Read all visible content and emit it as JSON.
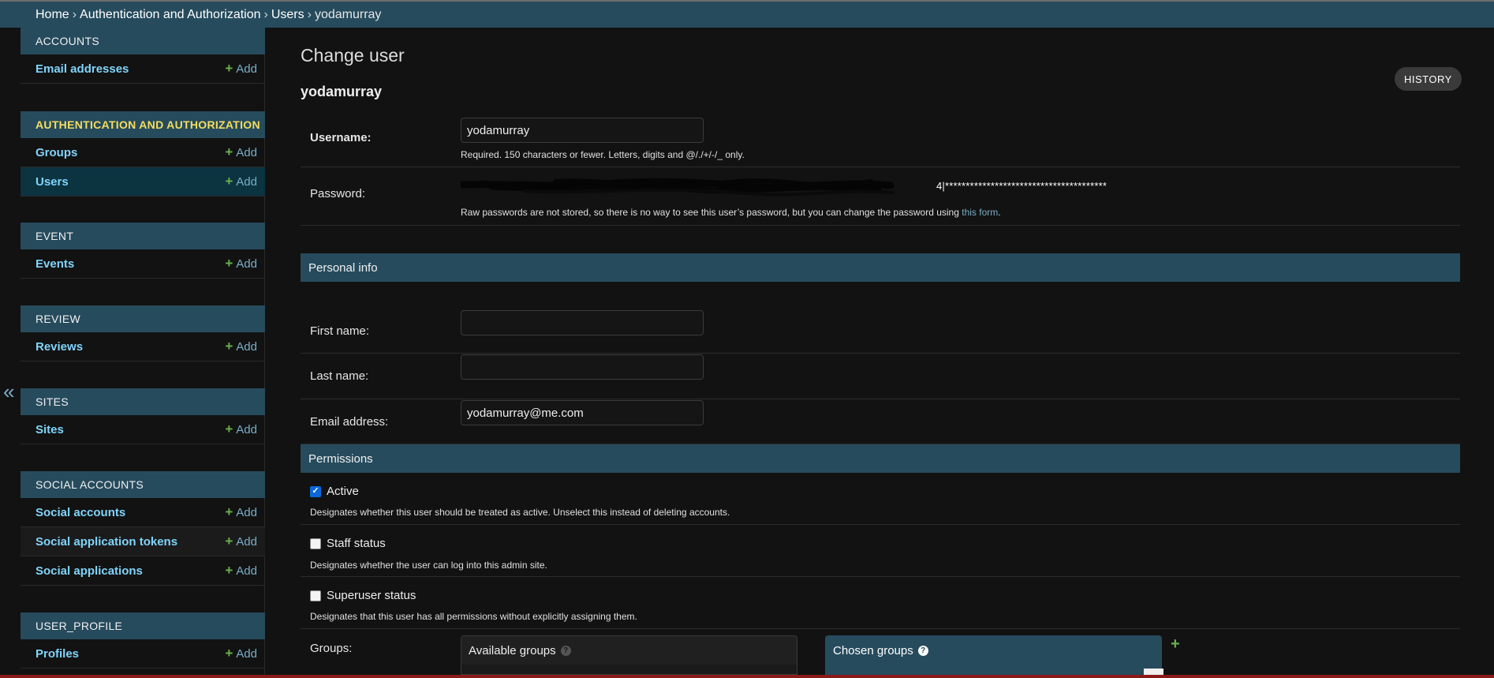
{
  "breadcrumbs": {
    "home": "Home",
    "app": "Authentication and Authorization",
    "model": "Users",
    "object": "yodamurray",
    "separator": "›"
  },
  "sidebar": {
    "collapse_symbol": "«",
    "add_label": "Add",
    "add_symbol": "+",
    "modules": [
      {
        "title": "ACCOUNTS",
        "items": [
          {
            "label": "Email addresses"
          }
        ]
      },
      {
        "title": "AUTHENTICATION AND AUTHORIZATION",
        "items": [
          {
            "label": "Groups"
          },
          {
            "label": "Users"
          }
        ]
      },
      {
        "title": "EVENT",
        "items": [
          {
            "label": "Events"
          }
        ]
      },
      {
        "title": "REVIEW",
        "items": [
          {
            "label": "Reviews"
          }
        ]
      },
      {
        "title": "SITES",
        "items": [
          {
            "label": "Sites"
          }
        ]
      },
      {
        "title": "SOCIAL ACCOUNTS",
        "items": [
          {
            "label": "Social accounts"
          },
          {
            "label": "Social application tokens"
          },
          {
            "label": "Social applications"
          }
        ]
      },
      {
        "title": "USER_PROFILE",
        "items": [
          {
            "label": "Profiles"
          }
        ]
      }
    ]
  },
  "main": {
    "title": "Change user",
    "object_name": "yodamurray",
    "history_label": "HISTORY",
    "username": {
      "label": "Username:",
      "value": "yodamurray",
      "help": "Required. 150 characters or fewer. Letters, digits and @/./+/-/_ only."
    },
    "password": {
      "label": "Password:",
      "masked": "4|***************************************",
      "help_prefix": "Raw passwords are not stored, so there is no way to see this user’s password, but you can change the password using ",
      "help_link": "this form",
      "help_suffix": "."
    },
    "personal_info": {
      "title": "Personal info",
      "first_name": {
        "label": "First name:",
        "value": ""
      },
      "last_name": {
        "label": "Last name:",
        "value": ""
      },
      "email": {
        "label": "Email address:",
        "value": "yodamurray@me.com"
      }
    },
    "permissions": {
      "title": "Permissions",
      "active": {
        "label": "Active",
        "checked": true,
        "help": "Designates whether this user should be treated as active. Unselect this instead of deleting accounts."
      },
      "staff": {
        "label": "Staff status",
        "checked": false,
        "help": "Designates whether the user can log into this admin site."
      },
      "superuser": {
        "label": "Superuser status",
        "checked": false,
        "help": "Designates that this user has all permissions without explicitly assigning them."
      },
      "groups": {
        "label": "Groups:",
        "available_title": "Available groups",
        "chosen_title": "Chosen groups",
        "help_symbol": "?",
        "add_symbol": "+"
      }
    }
  },
  "colors": {
    "header_bg": "#264b5d",
    "link": "#81d4fa",
    "add_green": "#6ab04c",
    "page_bg": "#121212",
    "active_module": "#f5dd5d"
  }
}
